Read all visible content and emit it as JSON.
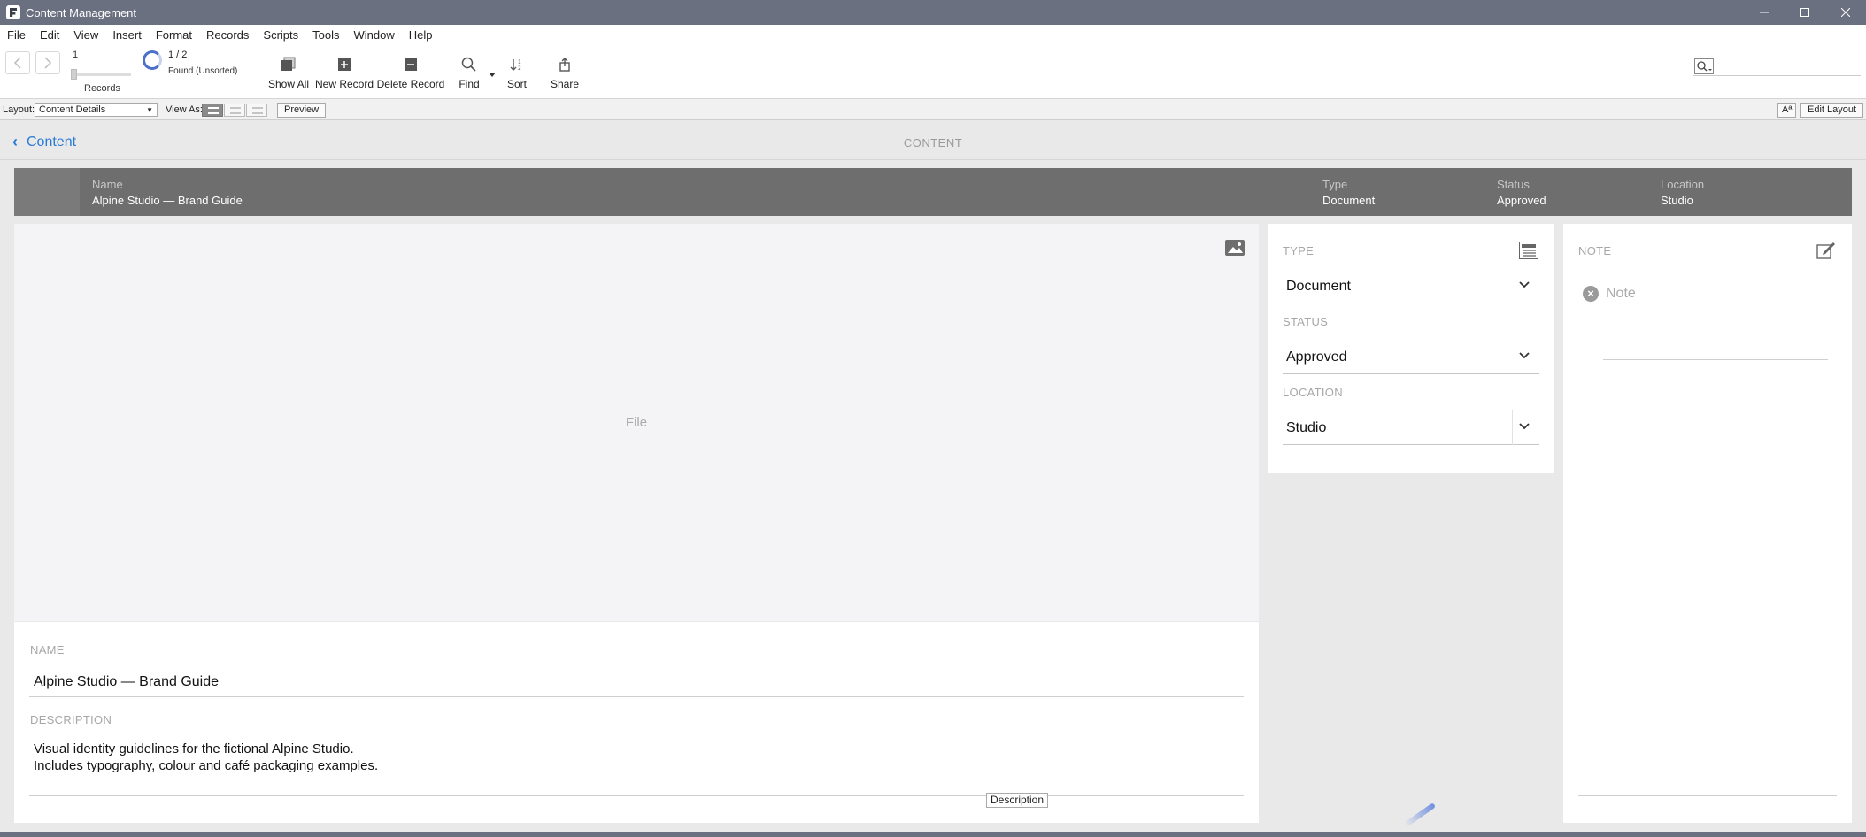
{
  "window": {
    "title": "Content Management",
    "controls": [
      "minimize",
      "maximize",
      "close"
    ]
  },
  "menubar": {
    "items": [
      "File",
      "Edit",
      "View",
      "Insert",
      "Format",
      "Records",
      "Scripts",
      "Tools",
      "Window",
      "Help"
    ]
  },
  "toolbar": {
    "record_number": "1",
    "records_label": "Records",
    "found_count": "1 / 2",
    "found_state": "Found (Unsorted)",
    "show_all": "Show All",
    "new_record": "New Record",
    "delete_record": "Delete Record",
    "find": "Find",
    "sort": "Sort",
    "share": "Share"
  },
  "layoutbar": {
    "layout_label": "Layout:",
    "layout_value": "Content Details",
    "view_as_label": "View As:",
    "preview": "Preview",
    "aa": "Aª",
    "edit_layout": "Edit Layout"
  },
  "header": {
    "back_label": "Content",
    "section_title": "CONTENT"
  },
  "summary": {
    "name_key": "Name",
    "name_value": "Alpine Studio — Brand Guide",
    "type_key": "Type",
    "type_value": "Document",
    "status_key": "Status",
    "status_value": "Approved",
    "location_key": "Location",
    "location_value": "Studio"
  },
  "file_panel": {
    "placeholder": "File"
  },
  "details": {
    "name_label": "NAME",
    "name_value": "Alpine Studio — Brand Guide",
    "description_label": "DESCRIPTION",
    "description_line1": "Visual identity guidelines for the fictional Alpine Studio.",
    "description_line2": "Includes typography, colour and café packaging examples.",
    "description_tag": "Description"
  },
  "form": {
    "type_label": "TYPE",
    "type_value": "Document",
    "status_label": "STATUS",
    "status_value": "Approved",
    "location_label": "LOCATION",
    "location_value": "Studio"
  },
  "note": {
    "label": "NOTE",
    "placeholder": "Note"
  },
  "colors": {
    "titlebar": "#6b7080",
    "link": "#2a7bd3",
    "summary_band": "#6e6e6e"
  }
}
